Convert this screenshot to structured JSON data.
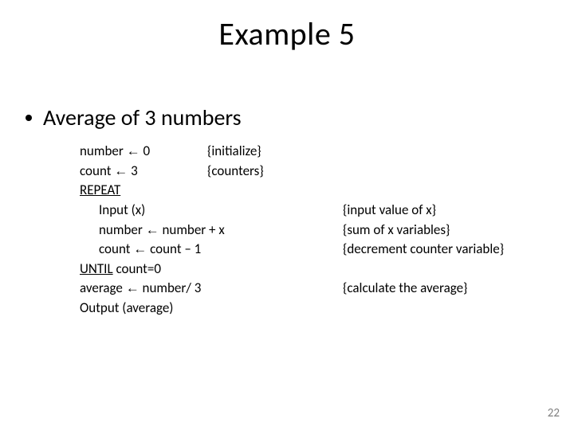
{
  "title": "Example 5",
  "bullet": "Average of 3 numbers",
  "arrow": "←",
  "code": {
    "l1_left": "number ",
    "l1_right": " 0",
    "l1_comment": "{initialize}",
    "l2_left": "count ",
    "l2_right": " 3",
    "l2_comment": "{counters}",
    "l3": "REPEAT",
    "l4": "Input (x)",
    "l4_comment": "{input value of x}",
    "l5_left": "number ",
    "l5_right": " number + x",
    "l5_comment": "{sum of x variables}",
    "l6_left": "count ",
    "l6_right": " count – 1",
    "l6_comment": "{decrement counter variable}",
    "l7_u": "UNTIL",
    "l7_rest": " count=0",
    "l8_left": "average ",
    "l8_right": " number/ 3",
    "l8_comment": "{calculate the average}",
    "l9": "Output (average)"
  },
  "page": "22"
}
